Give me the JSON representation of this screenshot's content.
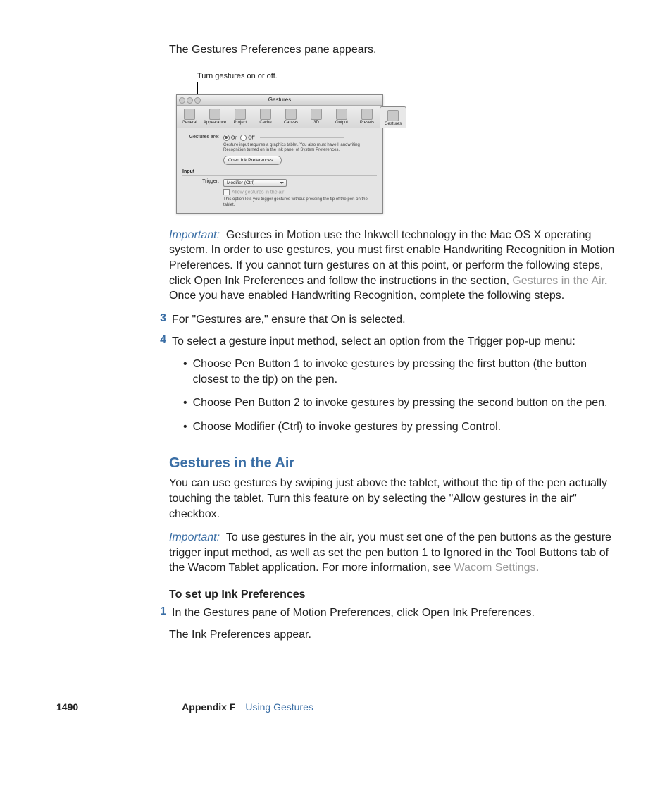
{
  "intro": "The Gestures Preferences pane appears.",
  "callout": "Turn gestures on or off.",
  "prefs": {
    "title": "Gestures",
    "tabs": [
      "General",
      "Appearance",
      "Project",
      "Cache",
      "Canvas",
      "3D",
      "Output",
      "Presets",
      "Gestures"
    ],
    "gestures_label": "Gestures are:",
    "on": "On",
    "off": "Off",
    "note1": "Gesture input requires a graphics tablet. You also must have Handwriting Recognition turned on in the Ink panel of System Preferences.",
    "open_ink": "Open Ink Preferences...",
    "input_section": "Input",
    "trigger_label": "Trigger:",
    "trigger_value": "Modifier (Ctrl)",
    "allow_air": "Allow gestures in the air",
    "note2": "This option lets you trigger gestures without pressing the tip of the pen on the tablet."
  },
  "important1_label": "Important:",
  "important1_a": "Gestures in Motion use the Inkwell technology in the Mac OS X operating system. In order to use gestures, you must first enable Handwriting Recognition in Motion Preferences. If you cannot turn gestures on at this point, or perform the following steps, click Open Ink Preferences and follow the instructions in the section, ",
  "important1_link": "Gestures in the Air",
  "important1_b": ". Once you have enabled Handwriting Recognition, complete the following steps.",
  "step3_num": "3",
  "step3_text": "For \"Gestures are,\" ensure that On is selected.",
  "step4_num": "4",
  "step4_text": "To select a gesture input method, select an option from the Trigger pop-up menu:",
  "bullets": [
    "Choose Pen Button 1 to invoke gestures by pressing the first button (the button closest to the tip) on the pen.",
    "Choose Pen Button 2 to invoke gestures by pressing the second button on the pen.",
    "Choose Modifier (Ctrl) to invoke gestures by pressing Control."
  ],
  "h3": "Gestures in the Air",
  "air_para": "You can use gestures by swiping just above the tablet, without the tip of the pen actually touching the tablet. Turn this feature on by selecting the \"Allow gestures in the air\" checkbox.",
  "important2_label": "Important:",
  "important2_a": "To use gestures in the air, you must set one of the pen buttons as the gesture trigger input method, as well as set the pen button 1 to Ignored in the Tool Buttons tab of the Wacom Tablet application. For more information, see ",
  "important2_link": "Wacom Settings",
  "important2_b": ".",
  "subhead": "To set up Ink Preferences",
  "step1_num": "1",
  "step1_text": "In the Gestures pane of Motion Preferences, click Open Ink Preferences.",
  "step1_follow": "The Ink Preferences appear.",
  "footer": {
    "page": "1490",
    "appendix": "Appendix F",
    "chapter": "Using Gestures"
  }
}
